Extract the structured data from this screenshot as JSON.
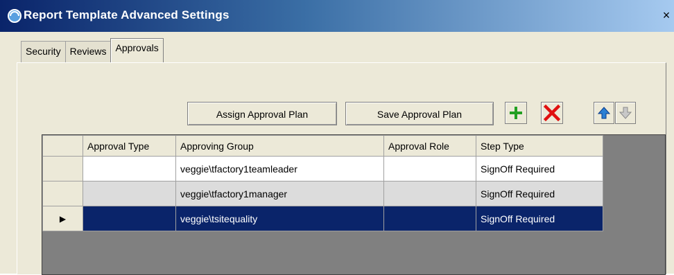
{
  "window": {
    "title": "Report Template Advanced Settings",
    "close_glyph": "×",
    "icon": "app-icon"
  },
  "tabs": [
    {
      "label": "Security",
      "active": false
    },
    {
      "label": "Reviews",
      "active": false
    },
    {
      "label": "Approvals",
      "active": true
    }
  ],
  "toolbar": {
    "assign_label": "Assign Approval Plan",
    "save_label": "Save Approval Plan",
    "add_icon": "plus-icon",
    "delete_icon": "x-icon",
    "up_icon": "arrow-up-icon",
    "down_icon": "arrow-down-icon"
  },
  "grid": {
    "columns": [
      "Approval Type",
      "Approving Group",
      "Approval Role",
      "Step Type"
    ],
    "rows": [
      {
        "approval_type": "",
        "approving_group": "veggie\\tfactory1teamleader",
        "approval_role": "",
        "step_type": "SignOff Required",
        "selected": false
      },
      {
        "approval_type": "",
        "approving_group": "veggie\\tfactory1manager",
        "approval_role": "",
        "step_type": "SignOff Required",
        "selected": false
      },
      {
        "approval_type": "",
        "approving_group": "veggie\\tsitequality",
        "approval_role": "",
        "step_type": "SignOff Required",
        "selected": true
      }
    ],
    "current_row_marker": "▶"
  },
  "colors": {
    "selection": "#0a246a",
    "titlebar_start": "#0a246a",
    "titlebar_end": "#a6caf0",
    "add_green": "#22a022",
    "delete_red": "#e01010",
    "up_blue": "#2a7fd4"
  }
}
